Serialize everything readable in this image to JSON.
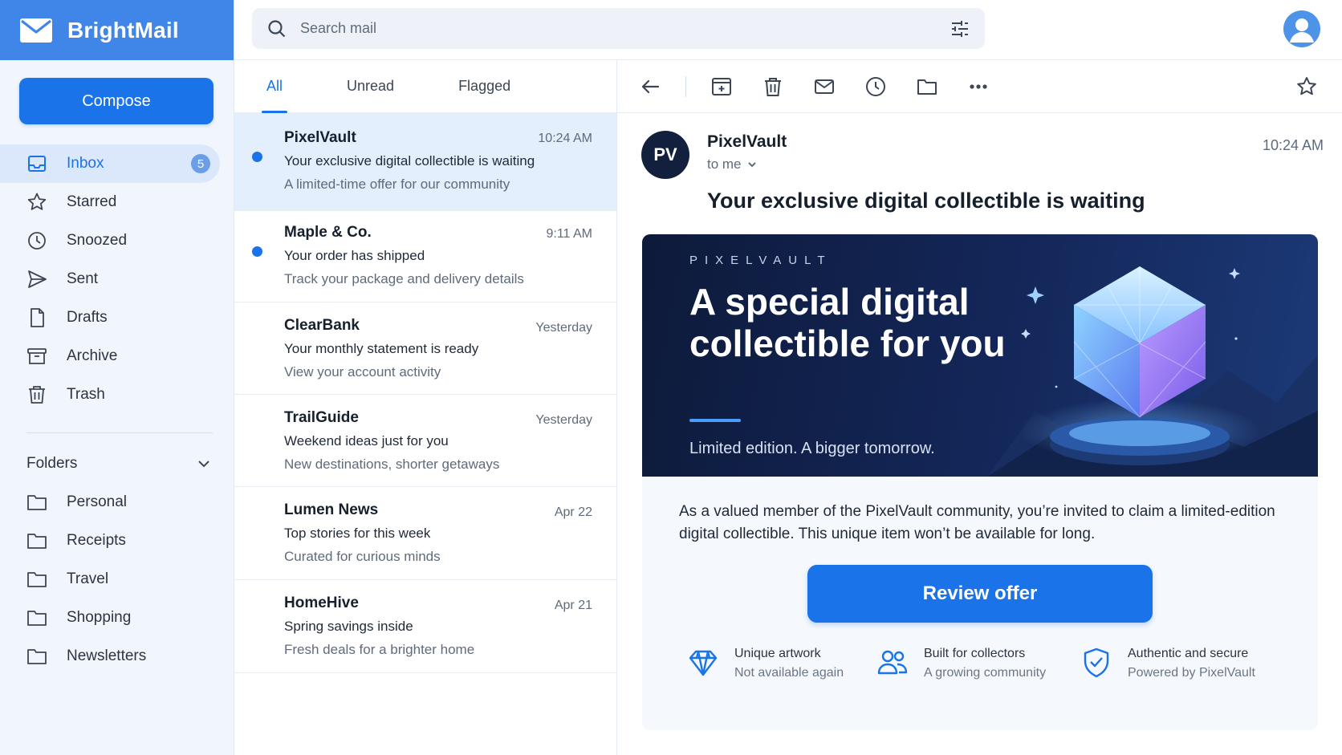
{
  "app": {
    "name": "BrightMail"
  },
  "sidebar": {
    "compose_label": "Compose",
    "items": [
      {
        "label": "Inbox",
        "icon": "inbox-icon",
        "badge": "5",
        "active": true
      },
      {
        "label": "Starred",
        "icon": "star-icon"
      },
      {
        "label": "Snoozed",
        "icon": "clock-icon"
      },
      {
        "label": "Sent",
        "icon": "send-icon"
      },
      {
        "label": "Drafts",
        "icon": "file-icon"
      },
      {
        "label": "Archive",
        "icon": "archive-icon"
      },
      {
        "label": "Trash",
        "icon": "trash-icon"
      }
    ],
    "folders_label": "Folders",
    "folders": [
      {
        "label": "Personal"
      },
      {
        "label": "Receipts"
      },
      {
        "label": "Travel"
      },
      {
        "label": "Shopping"
      },
      {
        "label": "Newsletters"
      }
    ]
  },
  "search": {
    "placeholder": "Search mail"
  },
  "list": {
    "tabs": [
      {
        "label": "All",
        "active": true
      },
      {
        "label": "Unread"
      },
      {
        "label": "Flagged"
      }
    ],
    "messages": [
      {
        "sender": "PixelVault",
        "time": "10:24 AM",
        "subject": "Your exclusive digital collectible is waiting",
        "snippet": "A limited-time offer for our community",
        "unread": true,
        "selected": true
      },
      {
        "sender": "Maple & Co.",
        "time": "9:11 AM",
        "subject": "Your order has shipped",
        "snippet": "Track your package and delivery details",
        "unread": true
      },
      {
        "sender": "ClearBank",
        "time": "Yesterday",
        "subject": "Your monthly statement is ready",
        "snippet": "View your account activity"
      },
      {
        "sender": "TrailGuide",
        "time": "Yesterday",
        "subject": "Weekend ideas just for you",
        "snippet": "New destinations, shorter getaways"
      },
      {
        "sender": "Lumen News",
        "time": "Apr 22",
        "subject": "Top stories for this week",
        "snippet": "Curated for curious minds"
      },
      {
        "sender": "HomeHive",
        "time": "Apr 21",
        "subject": "Spring savings inside",
        "snippet": "Fresh deals for a brighter home"
      }
    ]
  },
  "reader": {
    "avatar_initials": "PV",
    "from": "PixelVault",
    "to": "to me",
    "time": "10:24 AM",
    "subject": "Your exclusive digital collectible is waiting",
    "banner": {
      "eyebrow": "PIXELVAULT",
      "headline": "A special digital collectible for you",
      "tagline": "Limited edition. A bigger tomorrow."
    },
    "body": "As a valued member of the PixelVault community, you’re invited to claim a limited-edition digital collectible. This unique item won’t be available for long.",
    "cta_label": "Review offer",
    "features": [
      {
        "title": "Unique artwork",
        "subtitle": "Not available again",
        "icon": "diamond-icon"
      },
      {
        "title": "Built for collectors",
        "subtitle": "A growing community",
        "icon": "people-icon"
      },
      {
        "title": "Authentic and secure",
        "subtitle": "Powered by PixelVault",
        "icon": "shield-icon"
      }
    ]
  },
  "colors": {
    "accent": "#1a73e8",
    "brand_bar": "#3f86e8",
    "banner_bg": "#0d1a3a",
    "selected_row": "#e3effc"
  }
}
